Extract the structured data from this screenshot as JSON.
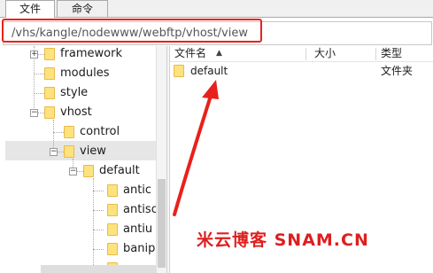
{
  "tabs": [
    {
      "label": "文件",
      "active": true
    },
    {
      "label": "命令",
      "active": false
    }
  ],
  "path": {
    "value": "/vhs/kangle/nodewww/webftp/vhost/view"
  },
  "tree": {
    "nodes": [
      {
        "label": "framework",
        "expanded": false
      },
      {
        "label": "modules"
      },
      {
        "label": "style"
      },
      {
        "label": "vhost",
        "expanded": true
      },
      {
        "label": "control"
      },
      {
        "label": "view",
        "expanded": true,
        "selected": true
      },
      {
        "label": "default",
        "expanded": true
      },
      {
        "label": "antic"
      },
      {
        "label": "antisc"
      },
      {
        "label": "antiu"
      },
      {
        "label": "banip"
      }
    ]
  },
  "list": {
    "columns": {
      "name": "文件名",
      "size": "大小",
      "type": "类型"
    },
    "rows": [
      {
        "name": "default",
        "size": "",
        "type": "文件夹",
        "icon": "folder-icon"
      }
    ]
  },
  "watermark": {
    "text": "米云博客 SNAM.CN"
  },
  "colors": {
    "annotation": "#e8211b",
    "folder": "#fde27e",
    "selection": "#e6e6e6"
  }
}
